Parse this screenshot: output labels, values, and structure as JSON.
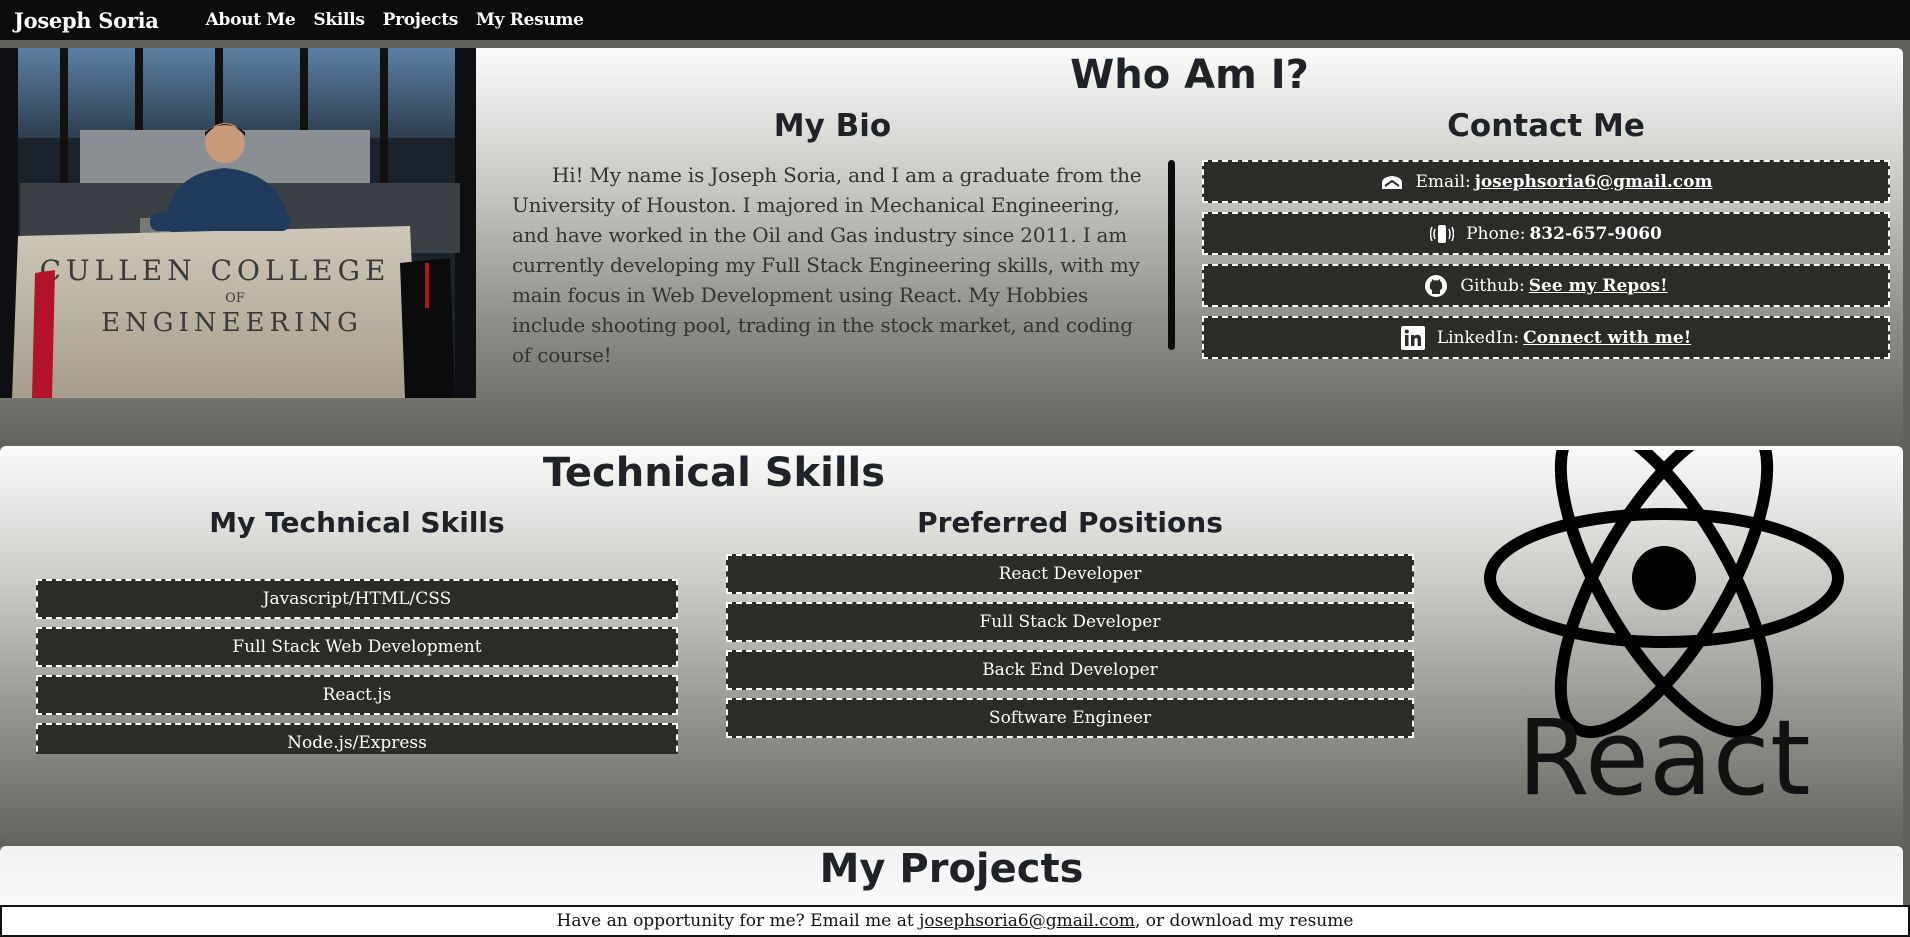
{
  "nav": {
    "brand": "Joseph Soria",
    "links": [
      "About Me",
      "Skills",
      "Projects",
      "My Resume"
    ]
  },
  "about": {
    "title": "Who Am I?",
    "bio_title": "My Bio",
    "bio_text": "Hi! My name is Joseph Soria, and I am a graduate from the University of Houston. I majored in Mechanical Engineering, and have worked in the Oil and Gas industry since 2011. I am currently developing my Full Stack Engineering skills, with my main focus in Web Development using React. My Hobbies include shooting pool, trading in the stock market, and coding of course!",
    "photo_sign": {
      "line1": "CULLEN  COLLEGE",
      "line2": "OF",
      "line3": "ENGINEERING"
    },
    "contact_title": "Contact Me",
    "contacts": [
      {
        "icon": "email-icon",
        "label": "Email:",
        "value": "josephsoria6@gmail.com",
        "kind": "link"
      },
      {
        "icon": "phone-icon",
        "label": "Phone:",
        "value": "832-657-9060",
        "kind": "text"
      },
      {
        "icon": "github-icon",
        "label": "Github:",
        "value": "See my Repos!",
        "kind": "link"
      },
      {
        "icon": "linkedin-icon",
        "label": "LinkedIn:",
        "value": "Connect with me!",
        "kind": "link"
      }
    ]
  },
  "skills": {
    "title": "Technical Skills",
    "tech_title": "My Technical Skills",
    "tech_items": [
      "Javascript/HTML/CSS",
      "Full Stack Web Development",
      "React.js",
      "Node.js/Express"
    ],
    "positions_title": "Preferred Positions",
    "positions": [
      "React Developer",
      "Full Stack Developer",
      "Back End Developer",
      "Software Engineer"
    ],
    "logo_text": "React"
  },
  "projects": {
    "title": "My Projects"
  },
  "footer": {
    "text_before": "Have an opportunity for me? Email me at ",
    "email": "josephsoria6@gmail.com",
    "text_after": ", or download my resume"
  },
  "colors": {
    "nav_bg": "#0c0c0a",
    "pill_bg": "#2b2b27",
    "page_bg": "#62625d"
  }
}
